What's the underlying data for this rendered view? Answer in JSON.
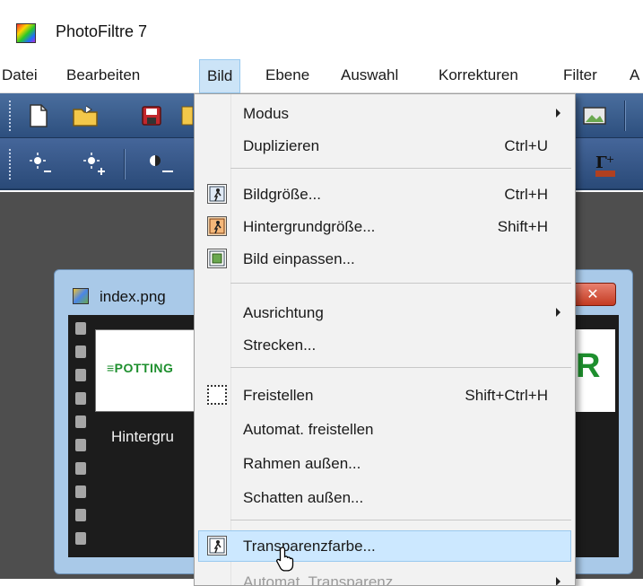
{
  "app": {
    "title": "PhotoFiltre 7"
  },
  "menubar": {
    "items": [
      {
        "label": "Datei"
      },
      {
        "label": "Bearbeiten"
      },
      {
        "label": "Bild"
      },
      {
        "label": "Ebene"
      },
      {
        "label": "Auswahl"
      },
      {
        "label": "Korrekturen"
      },
      {
        "label": "Filter"
      },
      {
        "label": "A"
      }
    ],
    "active": "Bild"
  },
  "dropdown": {
    "items": [
      {
        "label": "Modus",
        "shortcut": "",
        "submenu": true
      },
      {
        "label": "Duplizieren",
        "shortcut": "Ctrl+U"
      },
      {
        "label": "Bildgröße...",
        "shortcut": "Ctrl+H",
        "icon": "image-size-icon"
      },
      {
        "label": "Hintergrundgröße...",
        "shortcut": "Shift+H",
        "icon": "canvas-size-icon"
      },
      {
        "label": "Bild einpassen...",
        "shortcut": "",
        "icon": "fit-image-icon"
      },
      {
        "label": "Ausrichtung",
        "shortcut": "",
        "submenu": true
      },
      {
        "label": "Strecken...",
        "shortcut": ""
      },
      {
        "label": "Freistellen",
        "shortcut": "Shift+Ctrl+H",
        "icon": "crop-icon"
      },
      {
        "label": "Automat. freistellen",
        "shortcut": ""
      },
      {
        "label": "Rahmen außen...",
        "shortcut": ""
      },
      {
        "label": "Schatten außen...",
        "shortcut": ""
      },
      {
        "label": "Transparenzfarbe...",
        "shortcut": "",
        "icon": "transparency-color-icon",
        "highlighted": true
      },
      {
        "label": "Automat. Transparenz",
        "shortcut": "",
        "submenu": true,
        "disabled": true
      }
    ]
  },
  "image_window": {
    "title": "index.png",
    "close_label": "✕",
    "layer_name": "Hintergru",
    "logo_text": "≡POTTING",
    "right_letter": "R"
  },
  "colors": {
    "toolbar": "#3a5c8c",
    "menu_highlight": "#cce8ff",
    "workspace": "#4e4e4e",
    "window_frame": "#a9c9e8",
    "logo_green": "#1e8f2e"
  }
}
